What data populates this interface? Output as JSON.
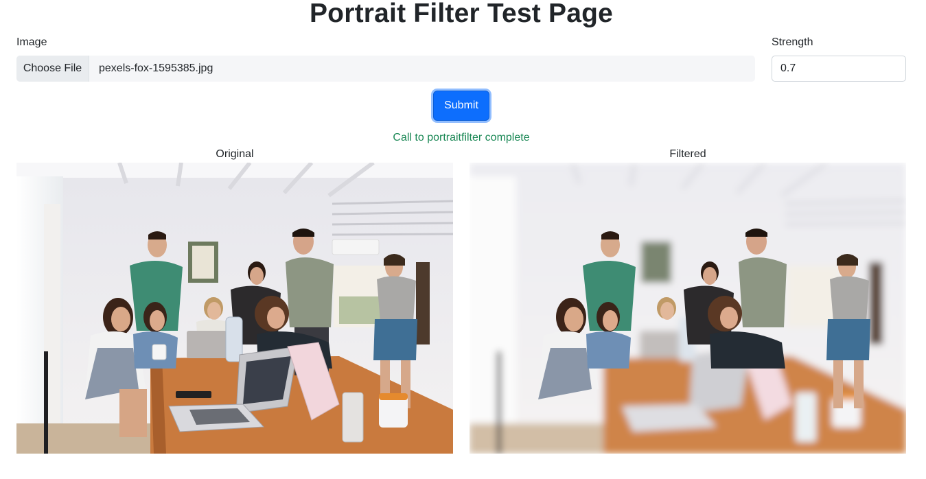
{
  "page": {
    "title": "Portrait Filter Test Page"
  },
  "form": {
    "image_label": "Image",
    "choose_file_label": "Choose File",
    "file_name": "pexels-fox-1595385.jpg",
    "strength_label": "Strength",
    "strength_value": "0.7",
    "submit_label": "Submit"
  },
  "status": {
    "message": "Call to portraitfilter complete",
    "color": "#198754"
  },
  "images": {
    "original_caption": "Original",
    "filtered_caption": "Filtered"
  },
  "colors": {
    "primary": "#0d6efd"
  }
}
